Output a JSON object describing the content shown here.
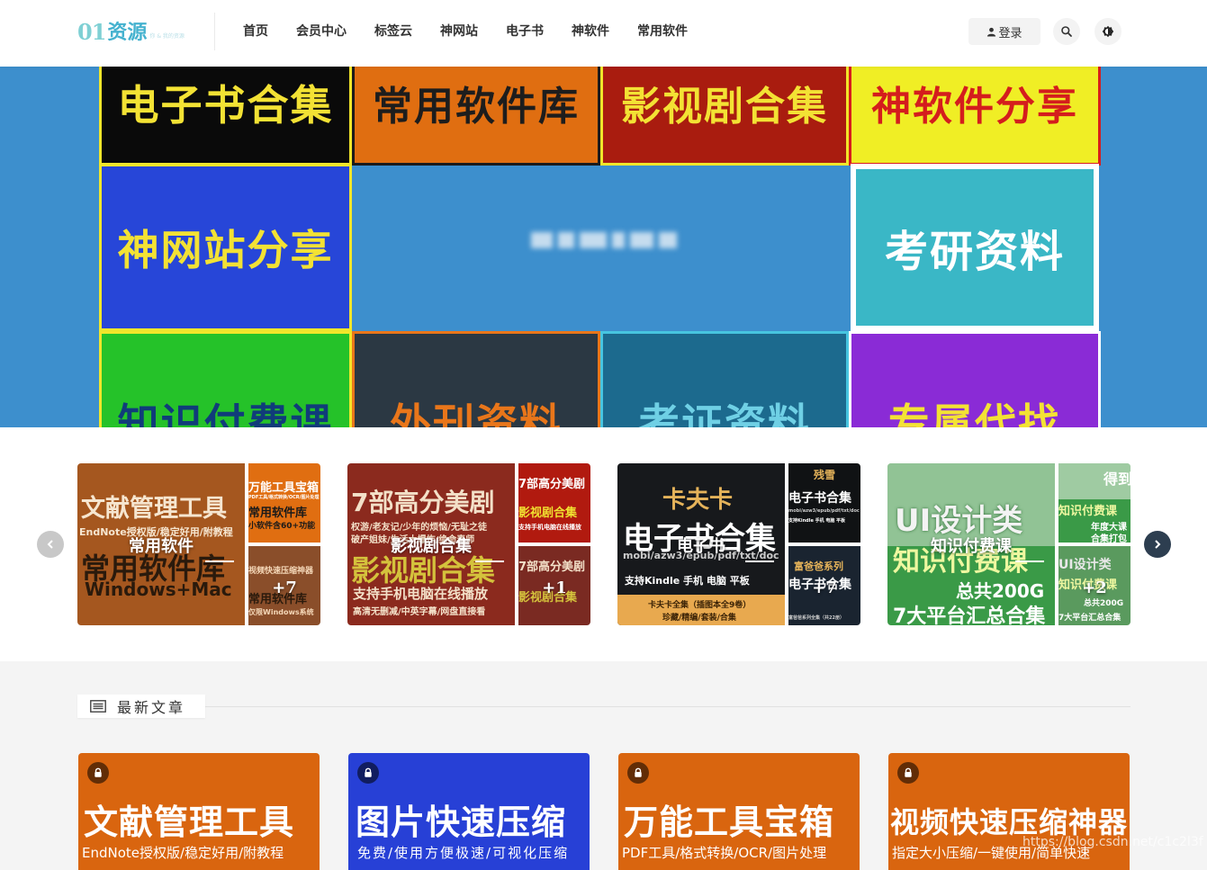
{
  "header": {
    "logo_number": "01",
    "logo_word": "资源",
    "logo_tagline": "你 & 我的资源",
    "nav": [
      "首页",
      "会员中心",
      "标签云",
      "神网站",
      "电子书",
      "神软件",
      "常用软件"
    ],
    "login_label": "登录"
  },
  "hero": {
    "tiles": [
      "电子书合集",
      "常用软件库",
      "影视剧合集",
      "神软件分享",
      "神网站分享",
      "考研资料",
      "知识付费课",
      "外刊资料",
      "考证资料",
      "专属代找"
    ]
  },
  "categories": [
    {
      "title": "常用软件",
      "count": "+7",
      "main_line1": "文献管理工具",
      "main_line2": "EndNote授权版/稳定好用/附教程",
      "main_line3": "常用软件库",
      "main_line4": "Windows+Mac",
      "side1_line1": "万能工具宝箱",
      "side1_line2": "PDF工具/格式转换/OCR/图片处理",
      "side1_line3": "常用软件库",
      "side1_line4": "小软件含60+功能",
      "side2_line1": "视频快速压缩神器",
      "side2_line2": "常用软件库",
      "side2_line3": "仅限Windows系统"
    },
    {
      "title": "影视剧合集",
      "count": "+1",
      "main_line1": "7部高分美剧",
      "main_line2": "权游/老友记/少年的烦恼/无耻之徒",
      "main_line3": "破产姐妹/生活大爆炸/绝命毒师",
      "main_line4": "影视剧合集",
      "main_line5": "支持手机电脑在线播放",
      "main_line6": "高清无删减/中英字幕/网盘直接看",
      "side1_line1": "7部高分美剧",
      "side1_line2": "影视剧合集",
      "side1_line3": "支持手机电脑在线播放",
      "side2_line1": "7部高分美剧",
      "side2_line2": "影视剧合集"
    },
    {
      "title": "电子书",
      "count": "+7",
      "main_line1": "卡夫卡",
      "main_line2": "电子书合集",
      "main_line3": "mobi/azw3/epub/pdf/txt/doc",
      "main_line4": "支持Kindle   手机   电脑   平板",
      "main_line5": "卡夫卡全集（插图本全9卷）",
      "main_line6": "珍藏/精编/套装/合集",
      "side1_line1": "残雪",
      "side1_line2": "电子书合集",
      "side1_line3": "mobi/azw3/epub/pdf/txt/doc",
      "side1_line4": "支持Kindle  手机  电脑  平板",
      "side2_line1": "富爸爸系列",
      "side2_line2": "电子书合集",
      "side2_line3": "富爸爸系列全集（共22册）"
    },
    {
      "title": "知识付费课",
      "count": "+2",
      "main_line1": "UI设计类",
      "main_line2": "知识付费课",
      "main_line3": "总共200G",
      "main_line4": "7大平台汇总合集",
      "side1_line1": "得到",
      "side1_line2": "知识付费课",
      "side1_line3": "年度大课",
      "side1_line4": "合集打包",
      "side2_line1": "UI设计类",
      "side2_line2": "知识付费课",
      "side2_line3": "总共200G",
      "side2_line4": "7大平台汇总合集"
    }
  ],
  "latest": {
    "heading": "最新文章",
    "posts": [
      {
        "title": "文献管理工具",
        "subtitle": "EndNote授权版/稳定好用/附教程"
      },
      {
        "title": "图片快速压缩",
        "subtitle": "免费/使用方便极速/可视化压缩"
      },
      {
        "title": "万能工具宝箱",
        "subtitle": "PDF工具/格式转换/OCR/图片处理"
      },
      {
        "title": "视频快速压缩神器",
        "subtitle": "指定大小压缩/一键使用/简单快速"
      }
    ]
  },
  "watermark": "https://blog.csdn.net/c1c2l3f",
  "colors": {
    "hero_bg": "#3d8fcd",
    "orange": "#d9650f",
    "blue_post": "#2740d6",
    "dark_nav_arrow": "#2d3e50",
    "grey_nav_arrow": "#c8c8c8"
  }
}
